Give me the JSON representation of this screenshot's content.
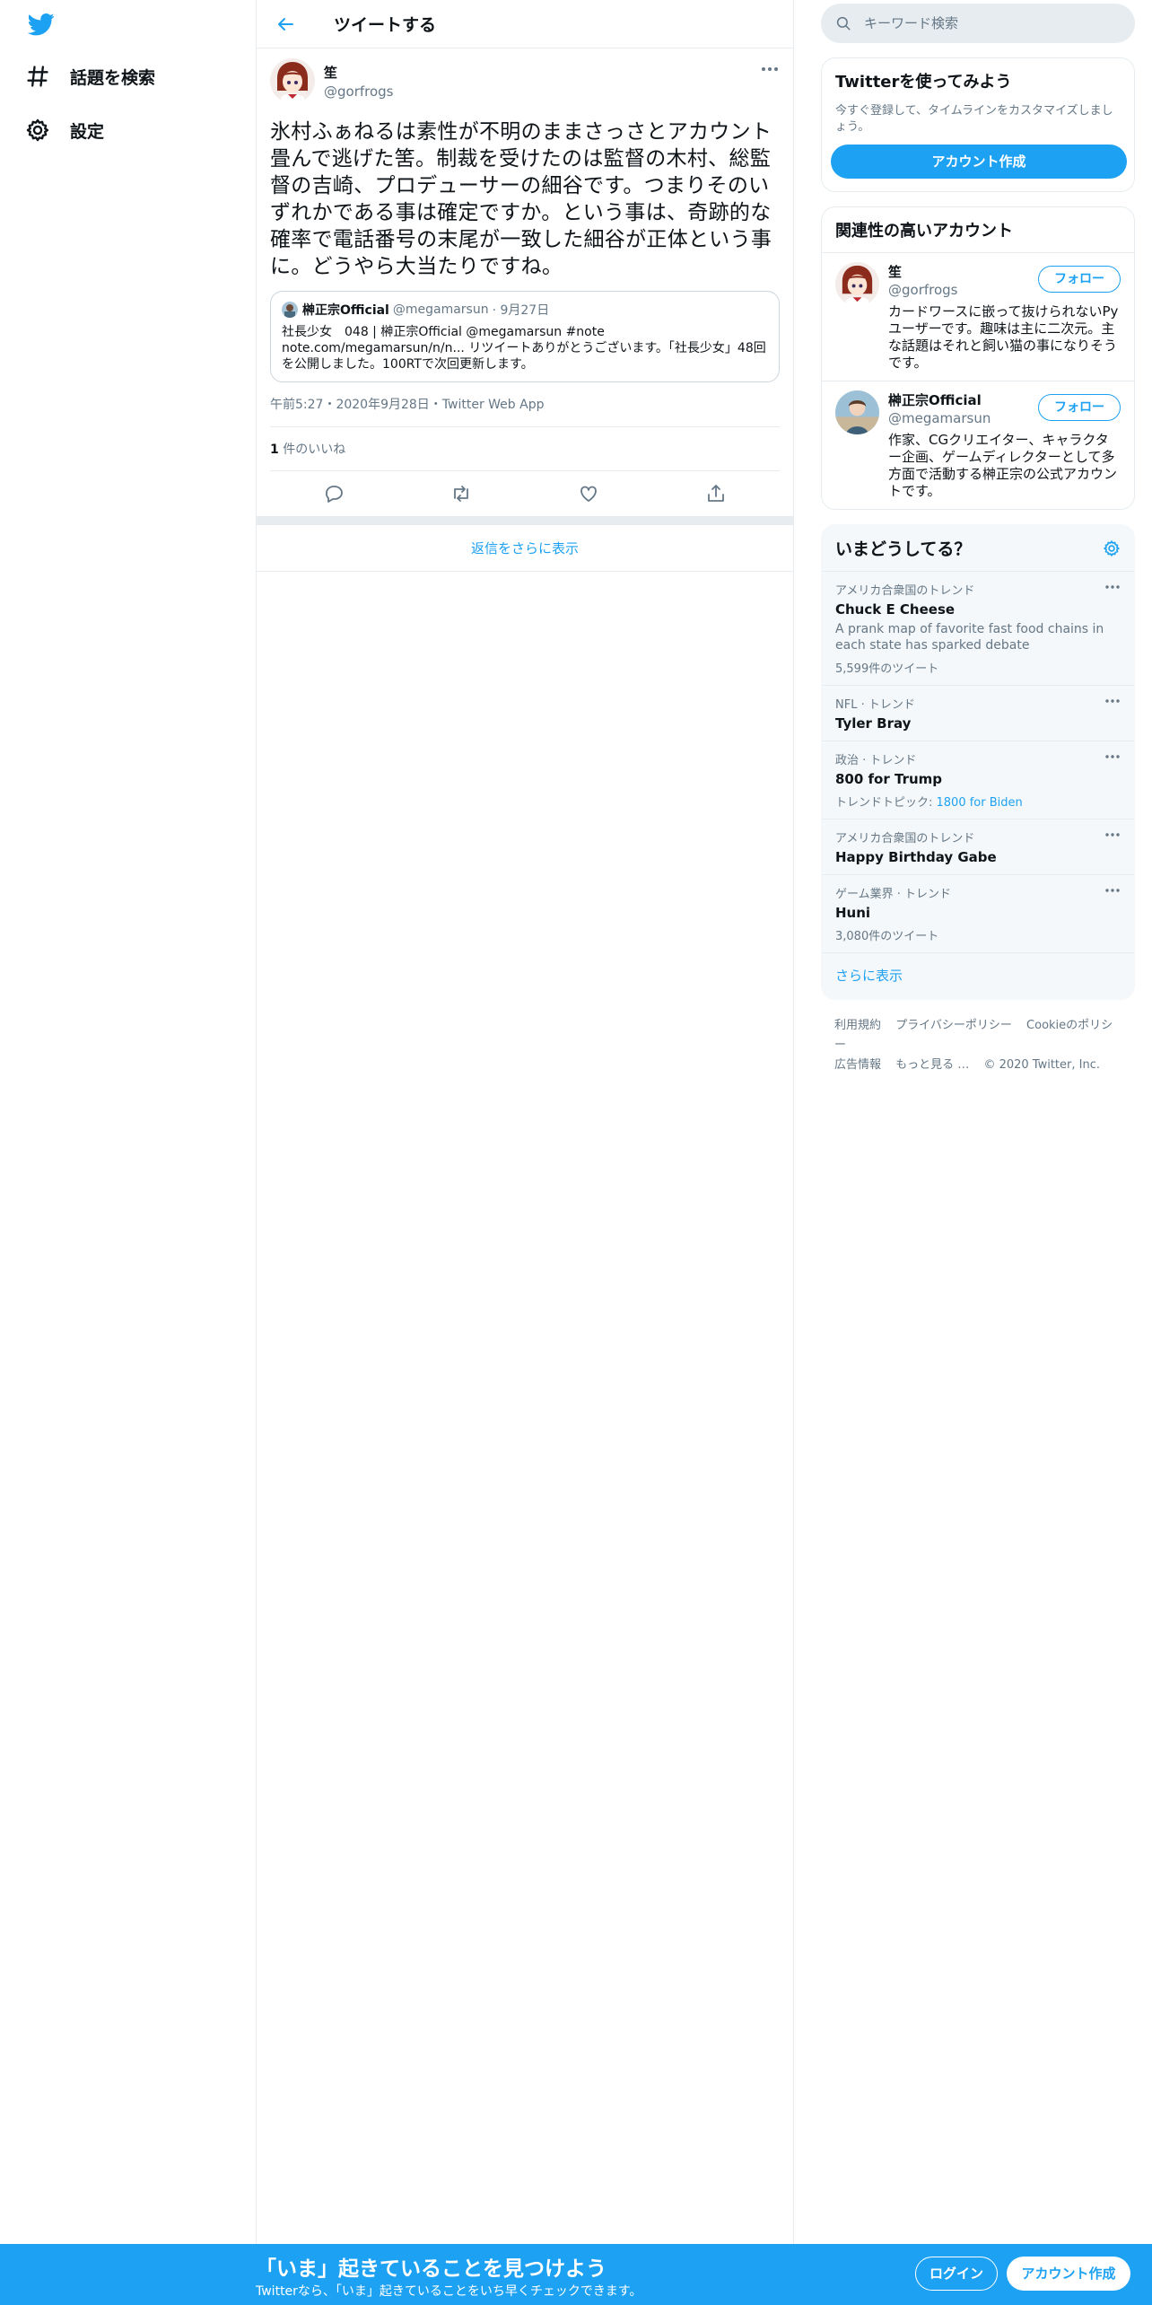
{
  "colors": {
    "accent": "#1da1f2",
    "secondary_text": "#657786",
    "border": "#e6ecf0"
  },
  "nav": {
    "logo_icon": "twitter-bird-icon",
    "items": [
      {
        "label": "話題を検索",
        "icon": "hashtag-icon"
      },
      {
        "label": "設定",
        "icon": "gear-icon"
      }
    ]
  },
  "header": {
    "title": "ツイートする",
    "back_icon": "back-arrow-icon"
  },
  "tweet": {
    "author_name": "笙",
    "author_handle": "@gorfrogs",
    "text": "氷村ふぁねるは素性が不明のままさっさとアカウント畳んで逃げた筈。制裁を受けたのは監督の木村、総監督の吉崎、プロデューサーの細谷です。つまりそのいずれかである事は確定ですか。という事は、奇跡的な確率で電話番号の末尾が一致した細谷が正体という事に。どうやら大当たりですね。",
    "quote": {
      "name": "榊正宗Official",
      "handle": "@megamarsun",
      "date": "· 9月27日",
      "text": "社長少女　048 | 榊正宗Official @megamarsun #note note.com/megamarsun/n/n... リツイートありがとうございます。「社長少女」48回を公開しました。100RTで次回更新します。"
    },
    "meta": "午前5:27・2020年9月28日・Twitter Web App",
    "likes_count": "1",
    "likes_label": " 件のいいね"
  },
  "show_replies": "返信をさらに表示",
  "search": {
    "placeholder": "キーワード検索"
  },
  "signup_card": {
    "title": "Twitterを使ってみよう",
    "subtitle": "今すぐ登録して、タイムラインをカスタマイズしましょう。",
    "button": "アカウント作成"
  },
  "related": {
    "title": "関連性の高いアカウント",
    "accounts": [
      {
        "name": "笙",
        "handle": "@gorfrogs",
        "bio": "カードワースに嵌って抜けられないPyユーザーです。趣味は主に二次元。主な話題はそれと飼い猫の事になりそうです。",
        "follow": "フォロー"
      },
      {
        "name": "榊正宗Official",
        "handle": "@megamarsun",
        "bio": "作家、CGクリエイター、キャラクター企画、ゲームディレクターとして多方面で活動する榊正宗の公式アカウントです。",
        "follow": "フォロー"
      }
    ]
  },
  "trends": {
    "title": "いまどうしてる？",
    "items": [
      {
        "category": "アメリカ合衆国のトレンド",
        "name": "Chuck E Cheese",
        "desc": "A prank map of favorite fast food chains in each state has sparked debate",
        "count": "5,599件のツイート"
      },
      {
        "category": "NFL · トレンド",
        "name": "Tyler Bray"
      },
      {
        "category": "政治 · トレンド",
        "name": "800 for Trump",
        "topic_label": "トレンドトピック: ",
        "topic_link": "1800 for Biden"
      },
      {
        "category": "アメリカ合衆国のトレンド",
        "name": "Happy Birthday Gabe"
      },
      {
        "category": "ゲーム業界 · トレンド",
        "name": "Huni",
        "count": "3,080件のツイート"
      }
    ],
    "show_more": "さらに表示"
  },
  "footer": {
    "links": [
      "利用規約",
      "プライバシーポリシー",
      "Cookieのポリシー",
      "広告情報",
      "もっと見る …"
    ],
    "copyright": "© 2020 Twitter, Inc."
  },
  "banner": {
    "title": "「いま」起きていることを見つけよう",
    "subtitle": "Twitterなら、「いま」起きていることをいち早くチェックできます。",
    "login": "ログイン",
    "signup": "アカウント作成"
  }
}
